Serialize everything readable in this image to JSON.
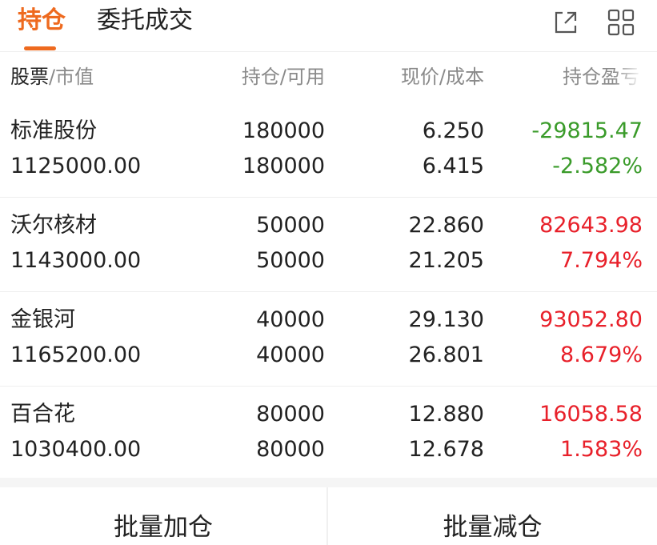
{
  "tabs": {
    "active": "持仓",
    "inactive": "委托成交"
  },
  "columns": {
    "c1_main": "股票",
    "c1_sep": "/",
    "c1_sub": "市值",
    "c2": "持仓/可用",
    "c3": "现价/成本",
    "c4": "持仓盈亏"
  },
  "rows": [
    {
      "name": "标准股份",
      "market_value": "1125000.00",
      "position": "180000",
      "available": "180000",
      "price": "6.250",
      "cost": "6.415",
      "pnl": "-29815.47",
      "pnl_pct": "-2.582%",
      "direction": "down"
    },
    {
      "name": "沃尔核材",
      "market_value": "1143000.00",
      "position": "50000",
      "available": "50000",
      "price": "22.860",
      "cost": "21.205",
      "pnl": "82643.98",
      "pnl_pct": "7.794%",
      "direction": "up"
    },
    {
      "name": "金银河",
      "market_value": "1165200.00",
      "position": "40000",
      "available": "40000",
      "price": "29.130",
      "cost": "26.801",
      "pnl": "93052.80",
      "pnl_pct": "8.679%",
      "direction": "up"
    },
    {
      "name": "百合花",
      "market_value": "1030400.00",
      "position": "80000",
      "available": "80000",
      "price": "12.880",
      "cost": "12.678",
      "pnl": "16058.58",
      "pnl_pct": "1.583%",
      "direction": "up"
    }
  ],
  "buttons": {
    "batch_add": "批量加仓",
    "batch_reduce": "批量减仓"
  },
  "colors": {
    "accent": "#ee6a1f",
    "up": "#e8202a",
    "down": "#3a9b2a"
  },
  "icons": {
    "share": "share-icon",
    "grid": "grid-icon"
  }
}
